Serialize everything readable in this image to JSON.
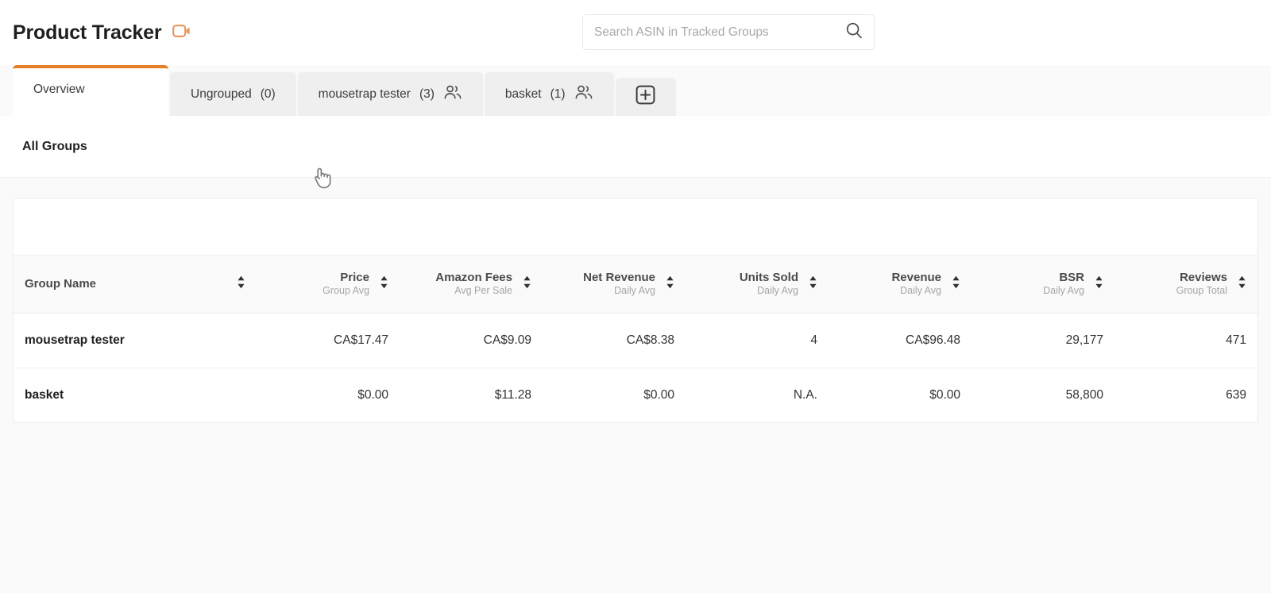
{
  "header": {
    "title": "Product Tracker",
    "video_icon": "video-camera-icon",
    "search": {
      "placeholder": "Search ASIN in Tracked Groups",
      "value": "",
      "icon": "search-icon"
    }
  },
  "tabs": {
    "items": [
      {
        "label": "Overview",
        "count": "",
        "active": true,
        "has_users_icon": false
      },
      {
        "label": "Ungrouped",
        "count": "(0)",
        "active": false,
        "has_users_icon": false
      },
      {
        "label": "mousetrap tester",
        "count": "(3)",
        "active": false,
        "has_users_icon": true
      },
      {
        "label": "basket",
        "count": "(1)",
        "active": false,
        "has_users_icon": true
      }
    ],
    "add_tab_icon": "plus-square-icon"
  },
  "section": {
    "all_groups_label": "All Groups"
  },
  "table": {
    "columns": [
      {
        "main": "Group Name",
        "sub": "",
        "align": "left"
      },
      {
        "main": "Price",
        "sub": "Group Avg",
        "align": "right"
      },
      {
        "main": "Amazon Fees",
        "sub": "Avg Per Sale",
        "align": "right"
      },
      {
        "main": "Net Revenue",
        "sub": "Daily Avg",
        "align": "right"
      },
      {
        "main": "Units Sold",
        "sub": "Daily Avg",
        "align": "right"
      },
      {
        "main": "Revenue",
        "sub": "Daily Avg",
        "align": "right"
      },
      {
        "main": "BSR",
        "sub": "Daily Avg",
        "align": "right"
      },
      {
        "main": "Reviews",
        "sub": "Group Total",
        "align": "right"
      }
    ],
    "rows": [
      {
        "group_name": "mousetrap tester",
        "price": "CA$17.47",
        "amazon_fees": "CA$9.09",
        "net_revenue": "CA$8.38",
        "units_sold": "4",
        "revenue": "CA$96.48",
        "bsr": "29,177",
        "reviews": "471"
      },
      {
        "group_name": "basket",
        "price": "$0.00",
        "amazon_fees": "$11.28",
        "net_revenue": "$0.00",
        "units_sold": "N.A.",
        "revenue": "$0.00",
        "bsr": "58,800",
        "reviews": "639"
      }
    ]
  },
  "colors": {
    "accent_orange": "#e4802a",
    "page_bg": "#fafafa",
    "surface": "#ffffff",
    "tab_inactive": "#efefef",
    "header_row_bg": "#fafafa"
  },
  "cursor": {
    "type": "pointing-hand"
  }
}
